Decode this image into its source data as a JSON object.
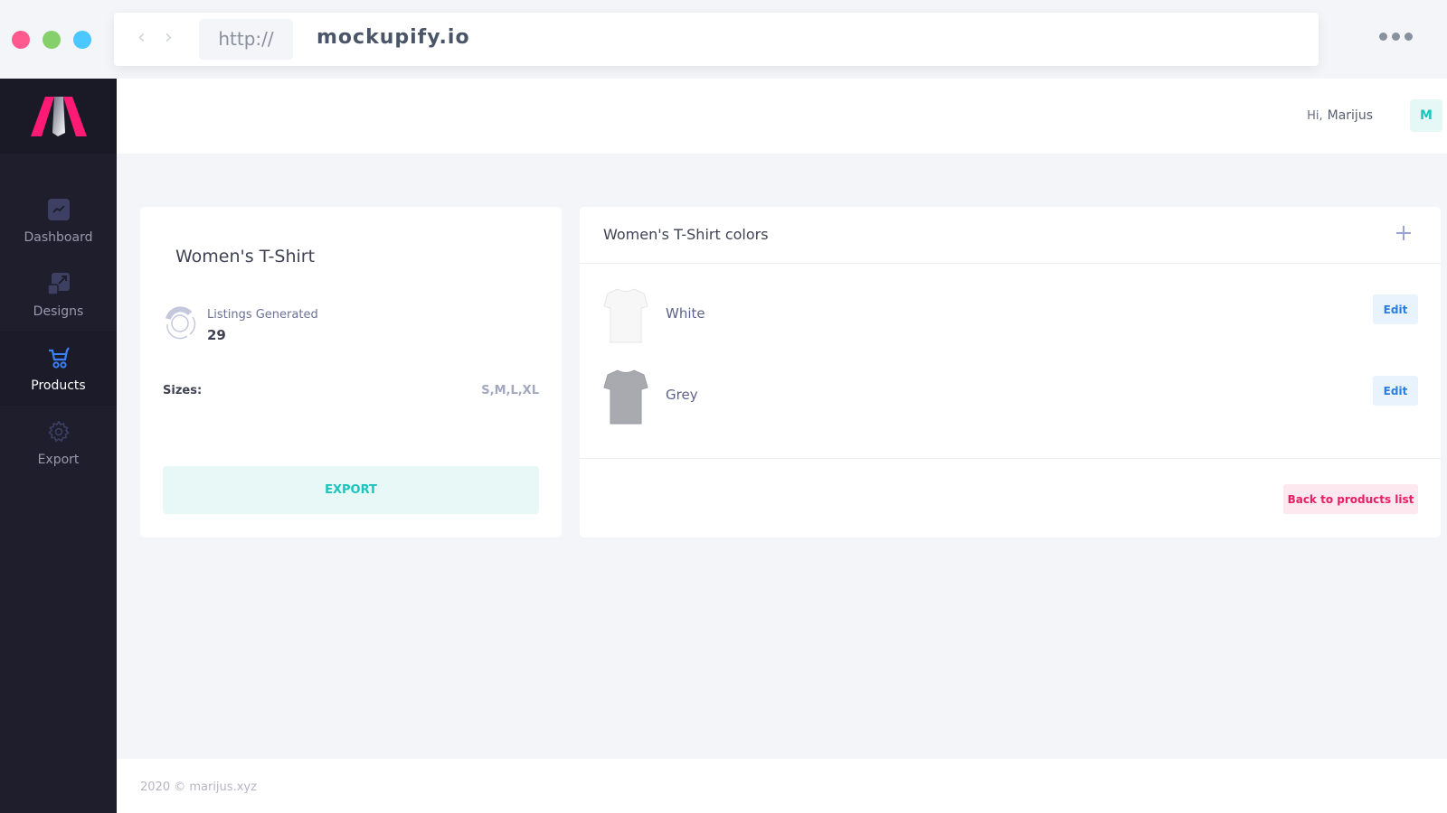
{
  "browser": {
    "protocol": "http://",
    "domain": "mockupify.io"
  },
  "sidebar": {
    "items": [
      {
        "label": "Dashboard",
        "icon": "trending-up-icon",
        "active": false
      },
      {
        "label": "Designs",
        "icon": "resize-icon",
        "active": false
      },
      {
        "label": "Products",
        "icon": "cart-icon",
        "active": true
      },
      {
        "label": "Export",
        "icon": "gear-icon",
        "active": false
      }
    ]
  },
  "header": {
    "greeting": "Hi,",
    "user_name": "Marijus",
    "avatar_initial": "M"
  },
  "product": {
    "title": "Women's T-Shirt",
    "stat_label": "Listings Generated",
    "stat_value": "29",
    "sizes_label": "Sizes:",
    "sizes_value": "S,M,L,XL",
    "export_label": "EXPORT"
  },
  "colors_panel": {
    "title": "Women's T-Shirt colors",
    "add_icon": "plus-icon",
    "items": [
      {
        "name": "White",
        "swatch": "#f7f7f7",
        "edit_label": "Edit"
      },
      {
        "name": "Grey",
        "swatch": "#a9a9b0",
        "edit_label": "Edit"
      }
    ],
    "back_label": "Back to products list"
  },
  "footer": {
    "text": "2020 © marijus.xyz"
  },
  "colors": {
    "accent_teal": "#1bc5bd",
    "accent_blue": "#2a7de1",
    "accent_pink": "#e91e63",
    "sidebar_bg": "#1e1e2d"
  }
}
